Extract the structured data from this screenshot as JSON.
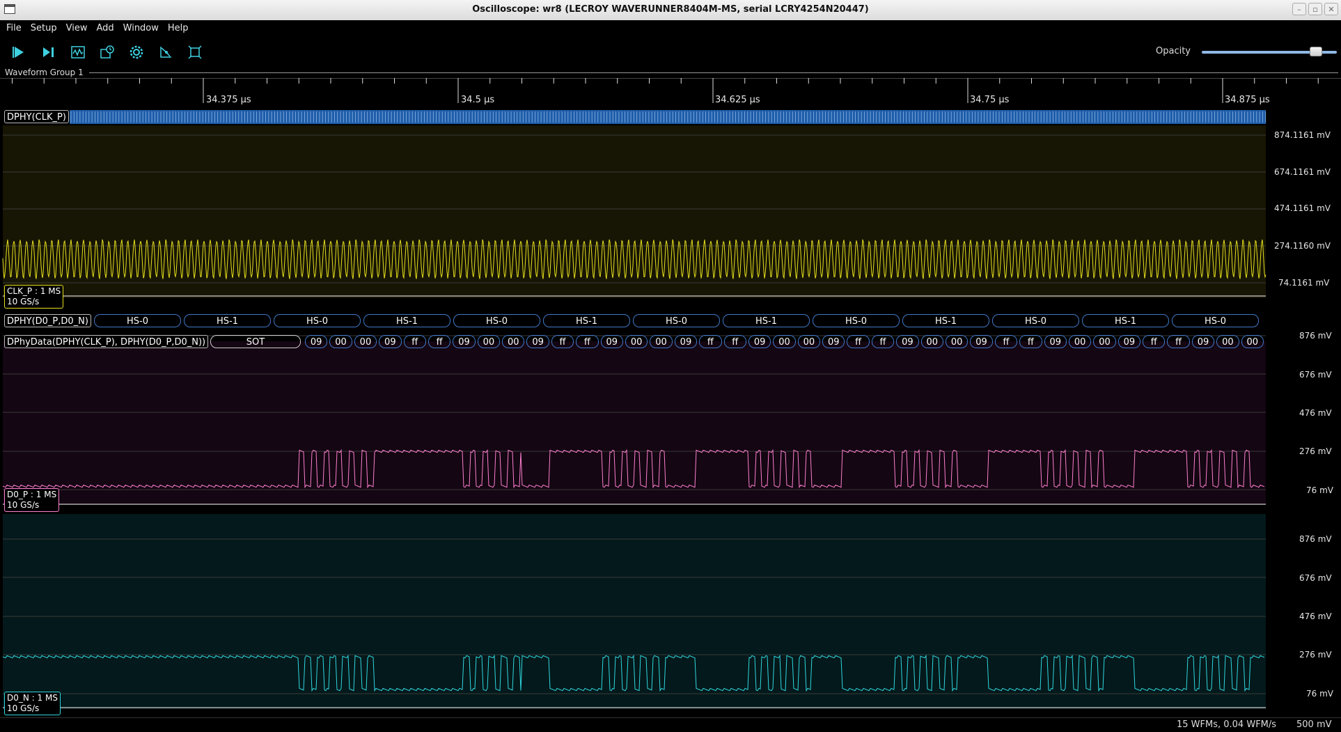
{
  "window": {
    "title": "Oscilloscope: wr8 (LECROY WAVERUNNER8404M-MS, serial LCRY4254N20447)"
  },
  "menu": [
    "File",
    "Setup",
    "View",
    "Add",
    "Window",
    "Help"
  ],
  "toolbar": {
    "buttons": [
      "start-icon",
      "single-trigger-icon",
      "waveform-icon",
      "history-icon",
      "settings-icon",
      "measure-icon",
      "fit-screen-icon"
    ],
    "opacity_label": "Opacity",
    "opacity_value": 0.88
  },
  "group": {
    "label": "Waveform Group 1"
  },
  "timeline": {
    "ticks": [
      "34.375 µs",
      "34.5 µs",
      "34.625 µs",
      "34.75 µs",
      "34.875 µs"
    ]
  },
  "lanes": {
    "clk_proto": "DPHY(CLK_P)",
    "d0_proto": "DPHY(D0_P,D0_N)",
    "data_proto": "DPhyData(DPHY(CLK_P), DPHY(D0_P,D0_N))",
    "d0_symbols": [
      "HS-0",
      "HS-1",
      "HS-0",
      "HS-1",
      "HS-0",
      "HS-1",
      "HS-0",
      "HS-1",
      "HS-0",
      "HS-1",
      "HS-0",
      "HS-1",
      "HS-0"
    ],
    "data_start": "SOT",
    "data_bytes": [
      "09",
      "00",
      "00",
      "09",
      "ff",
      "ff",
      "09",
      "00",
      "00",
      "09",
      "ff",
      "ff",
      "09",
      "00",
      "00",
      "09",
      "ff",
      "ff",
      "09",
      "00",
      "00",
      "09",
      "ff",
      "ff",
      "09",
      "00",
      "00",
      "09",
      "ff",
      "ff",
      "09",
      "00",
      "00",
      "09",
      "ff",
      "ff",
      "09",
      "00",
      "00"
    ]
  },
  "channels": [
    {
      "name": "CLK_P : 1 MS",
      "rate": "10 GS/s",
      "color": "#e6e01e",
      "axis": [
        "874.1161 mV",
        "674.1161 mV",
        "474.1161 mV",
        "274.1160 mV",
        "74.1161 mV"
      ]
    },
    {
      "name": "D0_P : 1 MS",
      "rate": "10 GS/s",
      "color": "#ff7fd0",
      "axis": [
        "876 mV",
        "676 mV",
        "476 mV",
        "276 mV",
        "76 mV"
      ]
    },
    {
      "name": "D0_N : 1 MS",
      "rate": "10 GS/s",
      "color": "#2fd8e0",
      "axis": [
        "876 mV",
        "676 mV",
        "476 mV",
        "276 mV",
        "76 mV"
      ]
    }
  ],
  "status": {
    "wfms": "15 WFMs, 0.04 WFM/s",
    "scale": "500 mV"
  }
}
